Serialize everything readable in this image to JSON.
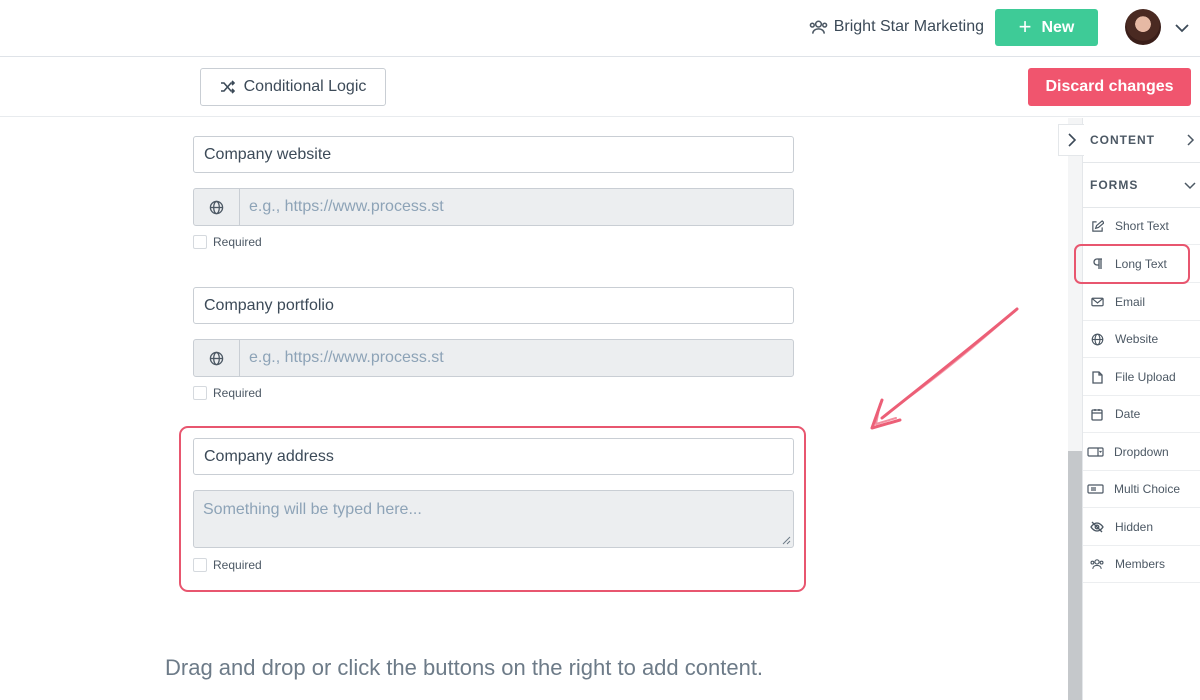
{
  "header": {
    "org_name": "Bright Star Marketing",
    "new_label": "New",
    "accent_color": "#3ecb97"
  },
  "toolbar": {
    "conditional_logic_label": "Conditional Logic",
    "discard_label": "Discard changes",
    "discard_color": "#f0556e"
  },
  "fields": [
    {
      "title": "Company website",
      "placeholder": "e.g., https://www.process.st",
      "required_label": "Required",
      "type": "website"
    },
    {
      "title": "Company portfolio",
      "placeholder": "e.g., https://www.process.st",
      "required_label": "Required",
      "type": "website"
    },
    {
      "title": "Company address",
      "placeholder": "Something will be typed here...",
      "required_label": "Required",
      "type": "long-text"
    }
  ],
  "footer_hint": "Drag and drop or click the buttons on the right to add content.",
  "sidebar": {
    "content_label": "CONTENT",
    "forms_label": "FORMS",
    "items": [
      {
        "label": "Short Text",
        "icon": "edit-icon"
      },
      {
        "label": "Long Text",
        "icon": "paragraph-icon"
      },
      {
        "label": "Email",
        "icon": "mail-icon"
      },
      {
        "label": "Website",
        "icon": "globe-icon"
      },
      {
        "label": "File Upload",
        "icon": "file-icon"
      },
      {
        "label": "Date",
        "icon": "calendar-icon"
      },
      {
        "label": "Dropdown",
        "icon": "dropdown-icon"
      },
      {
        "label": "Multi Choice",
        "icon": "multi-choice-icon"
      },
      {
        "label": "Hidden",
        "icon": "eye-slash-icon"
      },
      {
        "label": "Members",
        "icon": "users-icon"
      }
    ]
  },
  "annotation_color": "#e8566f"
}
